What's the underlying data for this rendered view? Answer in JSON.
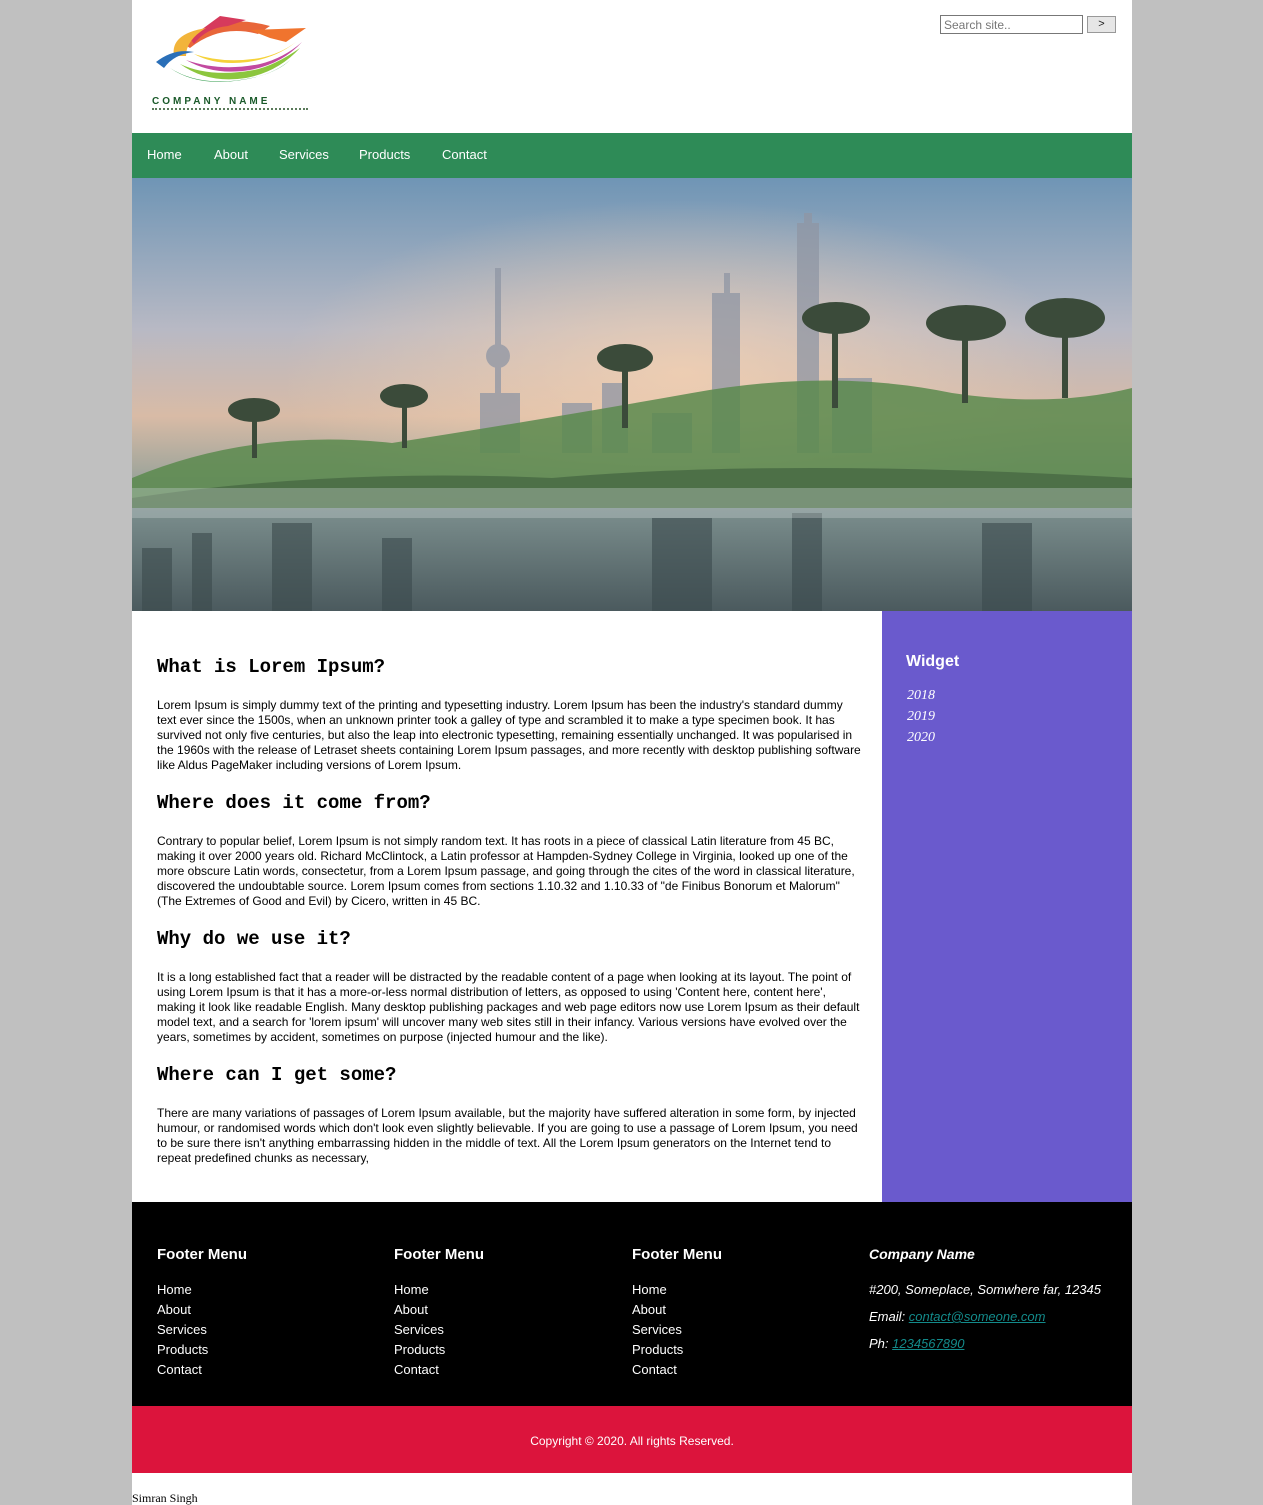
{
  "header": {
    "logo_text": "COMPANY NAME",
    "search_placeholder": "Search site..",
    "search_button": ">"
  },
  "nav": {
    "items": [
      "Home",
      "About",
      "Services",
      "Products",
      "Contact"
    ]
  },
  "main": {
    "sections": [
      {
        "heading": "What is Lorem Ipsum?",
        "body": "Lorem Ipsum is simply dummy text of the printing and typesetting industry. Lorem Ipsum has been the industry's standard dummy text ever since the 1500s, when an unknown printer took a galley of type and scrambled it to make a type specimen book. It has survived not only five centuries, but also the leap into electronic typesetting, remaining essentially unchanged. It was popularised in the 1960s with the release of Letraset sheets containing Lorem Ipsum passages, and more recently with desktop publishing software like Aldus PageMaker including versions of Lorem Ipsum."
      },
      {
        "heading": "Where does it come from?",
        "body": "Contrary to popular belief, Lorem Ipsum is not simply random text. It has roots in a piece of classical Latin literature from 45 BC, making it over 2000 years old. Richard McClintock, a Latin professor at Hampden-Sydney College in Virginia, looked up one of the more obscure Latin words, consectetur, from a Lorem Ipsum passage, and going through the cites of the word in classical literature, discovered the undoubtable source. Lorem Ipsum comes from sections 1.10.32 and 1.10.33 of \"de Finibus Bonorum et Malorum\" (The Extremes of Good and Evil) by Cicero, written in 45 BC."
      },
      {
        "heading": "Why do we use it?",
        "body": "It is a long established fact that a reader will be distracted by the readable content of a page when looking at its layout. The point of using Lorem Ipsum is that it has a more-or-less normal distribution of letters, as opposed to using 'Content here, content here', making it look like readable English. Many desktop publishing packages and web page editors now use Lorem Ipsum as their default model text, and a search for 'lorem ipsum' will uncover many web sites still in their infancy. Various versions have evolved over the years, sometimes by accident, sometimes on purpose (injected humour and the like)."
      },
      {
        "heading": "Where can I get some?",
        "body": "There are many variations of passages of Lorem Ipsum available, but the majority have suffered alteration in some form, by injected humour, or randomised words which don't look even slightly believable. If you are going to use a passage of Lorem Ipsum, you need to be sure there isn't anything embarrassing hidden in the middle of text. All the Lorem Ipsum generators on the Internet tend to repeat predefined chunks as necessary,"
      }
    ]
  },
  "widget": {
    "title": "Widget",
    "links": [
      "2018",
      "2019",
      "2020"
    ]
  },
  "footer": {
    "menus": [
      {
        "title": "Footer Menu",
        "items": [
          "Home",
          "About",
          "Services",
          "Products",
          "Contact"
        ]
      },
      {
        "title": "Footer Menu",
        "items": [
          "Home",
          "About",
          "Services",
          "Products",
          "Contact"
        ]
      },
      {
        "title": "Footer Menu",
        "items": [
          "Home",
          "About",
          "Services",
          "Products",
          "Contact"
        ]
      }
    ],
    "company": {
      "name": "Company Name",
      "address": "#200, Someplace, Somwhere far, 12345",
      "email_label": "Email: ",
      "email": "contact@someone.com",
      "phone_label": "Ph: ",
      "phone": "1234567890"
    }
  },
  "copyright": "Copyright © 2020. All rights Reserved.",
  "credit": "Simran Singh",
  "colors": {
    "nav": "#2e8b57",
    "widget": "#6a5acd",
    "footer": "#000000",
    "copyright": "#dc143c",
    "link": "#138a8a"
  }
}
